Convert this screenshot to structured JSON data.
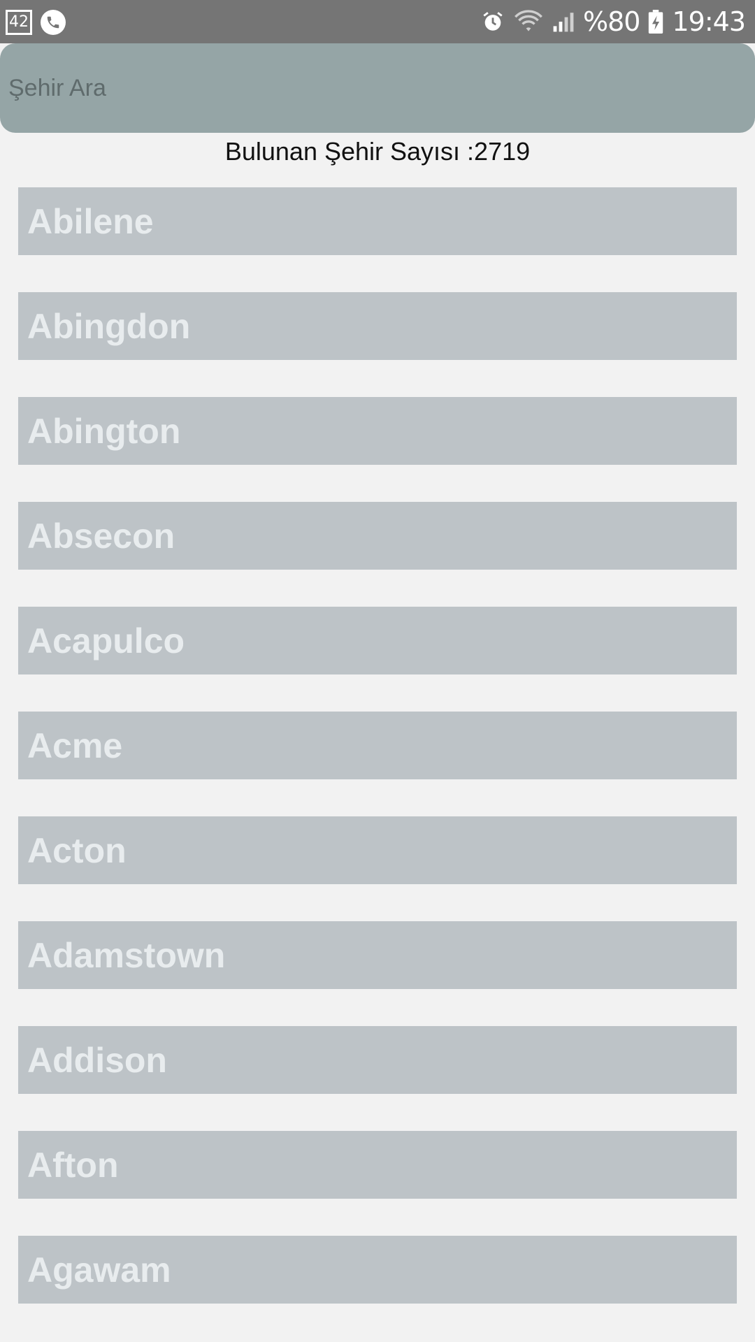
{
  "status_bar": {
    "notification_count": "42",
    "battery_percent": "%80",
    "time": "19:43",
    "icons": [
      "notification-box-icon",
      "phone-call-icon",
      "alarm-icon",
      "wifi-icon",
      "signal-icon",
      "battery-charging-icon"
    ]
  },
  "search": {
    "placeholder": "Şehir Ara",
    "value": ""
  },
  "result_count_text": "Bulunan Şehir Sayısı :2719",
  "cities": [
    "Abilene",
    "Abingdon",
    "Abington",
    "Absecon",
    "Acapulco",
    "Acme",
    "Acton",
    "Adamstown",
    "Addison",
    "Afton",
    "Agawam"
  ],
  "colors": {
    "status_bar": "#757575",
    "search_bar": "#95a5a6",
    "background": "#f2f2f2",
    "row_background": "#bdc3c7",
    "row_text": "#e8ecee"
  }
}
